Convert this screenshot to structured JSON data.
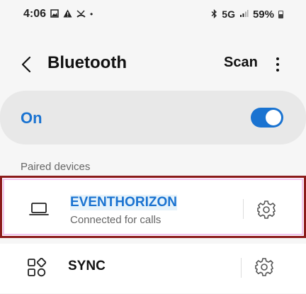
{
  "status_bar": {
    "time": "4:06",
    "dot": "•",
    "network": "5G",
    "battery": "59%"
  },
  "header": {
    "title": "Bluetooth",
    "scan_label": "Scan"
  },
  "bluetooth_toggle": {
    "label": "On",
    "state": "on",
    "accent_color": "#1a73d1"
  },
  "paired_devices": {
    "section_label": "Paired devices",
    "devices": [
      {
        "name": "EVENTHORIZON",
        "status": "Connected for calls",
        "icon": "laptop-icon",
        "selected": true
      },
      {
        "name": "SYNC",
        "status": "",
        "icon": "apps-grid-icon",
        "selected": false
      }
    ]
  }
}
